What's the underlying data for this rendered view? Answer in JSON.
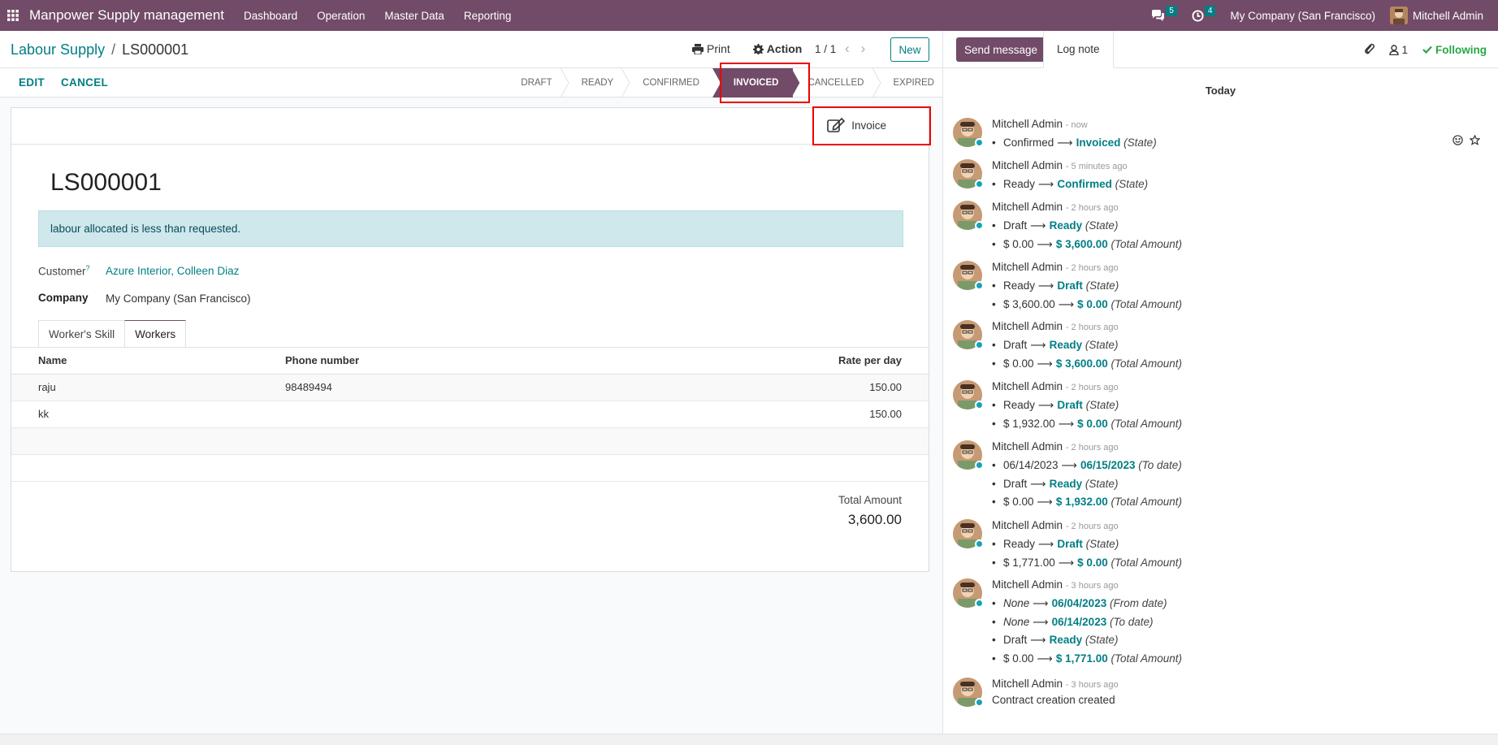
{
  "navbar": {
    "brand": "Manpower Supply management",
    "menu": [
      "Dashboard",
      "Operation",
      "Master Data",
      "Reporting"
    ],
    "messages_count": "5",
    "activities_count": "4",
    "company": "My Company (San Francisco)",
    "user": "Mitchell Admin",
    "color": "#714b67"
  },
  "breadcrumb": {
    "parent": "Labour Supply",
    "separator": "/",
    "current": "LS000001"
  },
  "control": {
    "print": "Print",
    "action": "Action",
    "pager": "1 / 1",
    "new": "New"
  },
  "statusbar": {
    "edit": "EDIT",
    "cancel": "CANCEL",
    "stages": [
      "DRAFT",
      "READY",
      "CONFIRMED",
      "INVOICED",
      "CANCELLED",
      "EXPIRED"
    ],
    "active_stage": "INVOICED"
  },
  "form": {
    "invoice_button": "Invoice",
    "name": "LS000001",
    "alert": "labour allocated is less than requested.",
    "customer_label": "Customer",
    "customer_help": "?",
    "customer_value": "Azure Interior, Colleen Diaz",
    "company_label": "Company",
    "company_value": "My Company (San Francisco)",
    "tabs": [
      "Worker's Skill",
      "Workers"
    ],
    "active_tab": "Workers",
    "columns": [
      "Name",
      "Phone number",
      "Rate per day"
    ],
    "rows": [
      {
        "name": "raju",
        "phone": "98489494",
        "rate": "150.00"
      },
      {
        "name": "kk",
        "phone": "",
        "rate": "150.00"
      }
    ],
    "total_label": "Total Amount",
    "total_value": "3,600.00"
  },
  "chatter": {
    "send_message": "Send message",
    "log_note": "Log note",
    "followers_count": "1",
    "following": "Following",
    "today": "Today",
    "author": "Mitchell Admin",
    "messages": [
      {
        "when": "- now",
        "changes": [
          {
            "old": "Confirmed",
            "new": "Invoiced",
            "field": "(State)"
          }
        ]
      },
      {
        "when": "- 5 minutes ago",
        "changes": [
          {
            "old": "Ready",
            "new": "Confirmed",
            "field": "(State)"
          }
        ]
      },
      {
        "when": "- 2 hours ago",
        "changes": [
          {
            "old": "Draft",
            "new": "Ready",
            "field": "(State)"
          },
          {
            "old": "$ 0.00",
            "new": "$ 3,600.00",
            "field": "(Total Amount)"
          }
        ]
      },
      {
        "when": "- 2 hours ago",
        "changes": [
          {
            "old": "Ready",
            "new": "Draft",
            "field": "(State)"
          },
          {
            "old": "$ 3,600.00",
            "new": "$ 0.00",
            "field": "(Total Amount)"
          }
        ]
      },
      {
        "when": "- 2 hours ago",
        "changes": [
          {
            "old": "Draft",
            "new": "Ready",
            "field": "(State)"
          },
          {
            "old": "$ 0.00",
            "new": "$ 3,600.00",
            "field": "(Total Amount)"
          }
        ]
      },
      {
        "when": "- 2 hours ago",
        "changes": [
          {
            "old": "Ready",
            "new": "Draft",
            "field": "(State)"
          },
          {
            "old": "$ 1,932.00",
            "new": "$ 0.00",
            "field": "(Total Amount)"
          }
        ]
      },
      {
        "when": "- 2 hours ago",
        "changes": [
          {
            "old": "06/14/2023",
            "new": "06/15/2023",
            "field": "(To date)"
          },
          {
            "old": "Draft",
            "new": "Ready",
            "field": "(State)"
          },
          {
            "old": "$ 0.00",
            "new": "$ 1,932.00",
            "field": "(Total Amount)"
          }
        ]
      },
      {
        "when": "- 2 hours ago",
        "changes": [
          {
            "old": "Ready",
            "new": "Draft",
            "field": "(State)"
          },
          {
            "old": "$ 1,771.00",
            "new": "$ 0.00",
            "field": "(Total Amount)"
          }
        ]
      },
      {
        "when": "- 3 hours ago",
        "changes": [
          {
            "old": "None",
            "new": "06/04/2023",
            "field": "(From date)"
          },
          {
            "old": "None",
            "new": "06/14/2023",
            "field": "(To date)"
          },
          {
            "old": "Draft",
            "new": "Ready",
            "field": "(State)"
          },
          {
            "old": "$ 0.00",
            "new": "$ 1,771.00",
            "field": "(Total Amount)"
          }
        ]
      },
      {
        "when": "- 3 hours ago",
        "body": "Contract creation created"
      }
    ]
  }
}
